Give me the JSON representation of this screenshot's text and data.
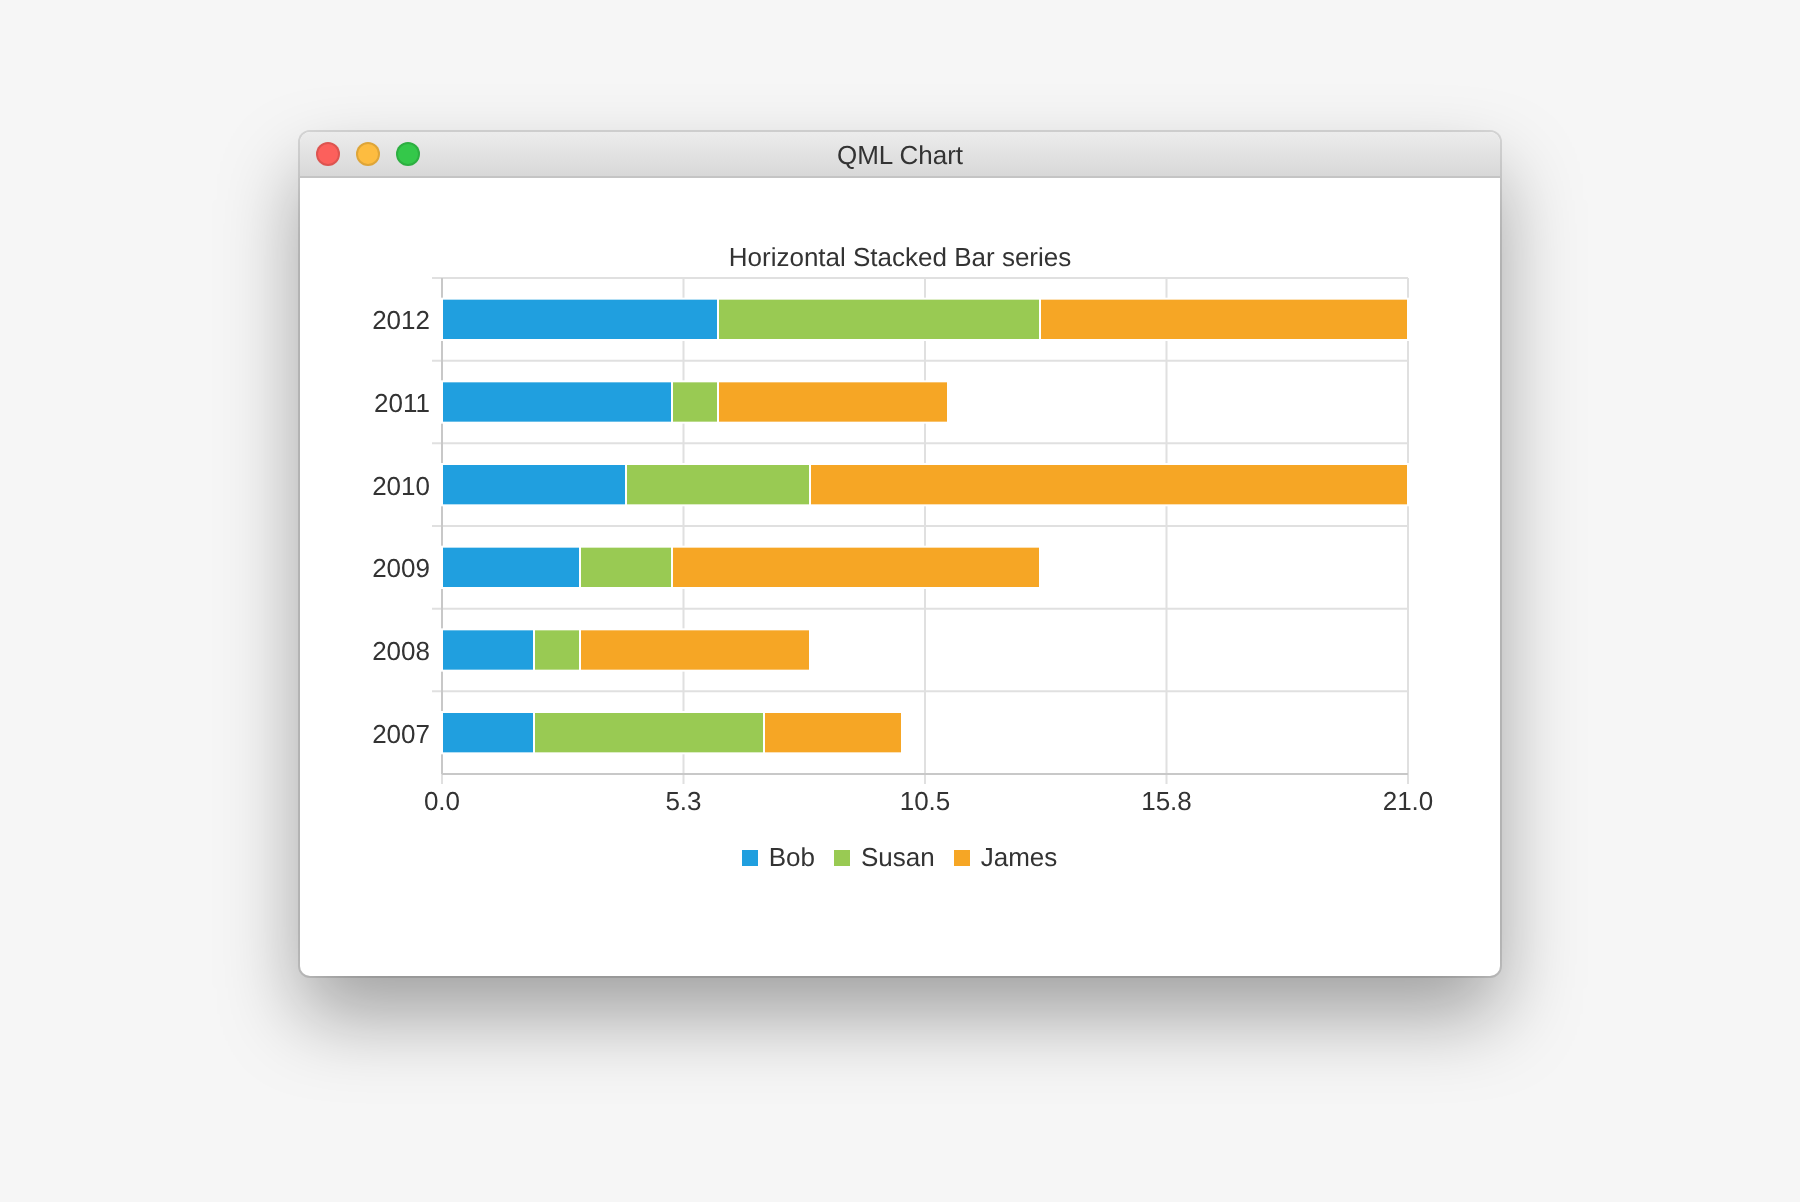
{
  "window": {
    "title": "QML Chart"
  },
  "chart": {
    "chart_data": {
      "type": "bar",
      "orientation": "horizontal",
      "stacked": true,
      "title": "Horizontal Stacked Bar series",
      "categories": [
        "2012",
        "2011",
        "2010",
        "2009",
        "2008",
        "2007"
      ],
      "series": [
        {
          "name": "Bob",
          "color": "#209fdf",
          "values": [
            6,
            5,
            4,
            3,
            2,
            2
          ]
        },
        {
          "name": "Susan",
          "color": "#99ca53",
          "values": [
            7,
            1,
            4,
            2,
            1,
            5
          ]
        },
        {
          "name": "James",
          "color": "#f6a625",
          "values": [
            8,
            5,
            13,
            8,
            5,
            3
          ]
        }
      ],
      "xlim": [
        0,
        21
      ],
      "xticks": [
        {
          "value": 0,
          "label": "0.0"
        },
        {
          "value": 5.25,
          "label": "5.3"
        },
        {
          "value": 10.5,
          "label": "10.5"
        },
        {
          "value": 15.75,
          "label": "15.8"
        },
        {
          "value": 21,
          "label": "21.0"
        }
      ],
      "grid": true,
      "legend": true
    }
  }
}
